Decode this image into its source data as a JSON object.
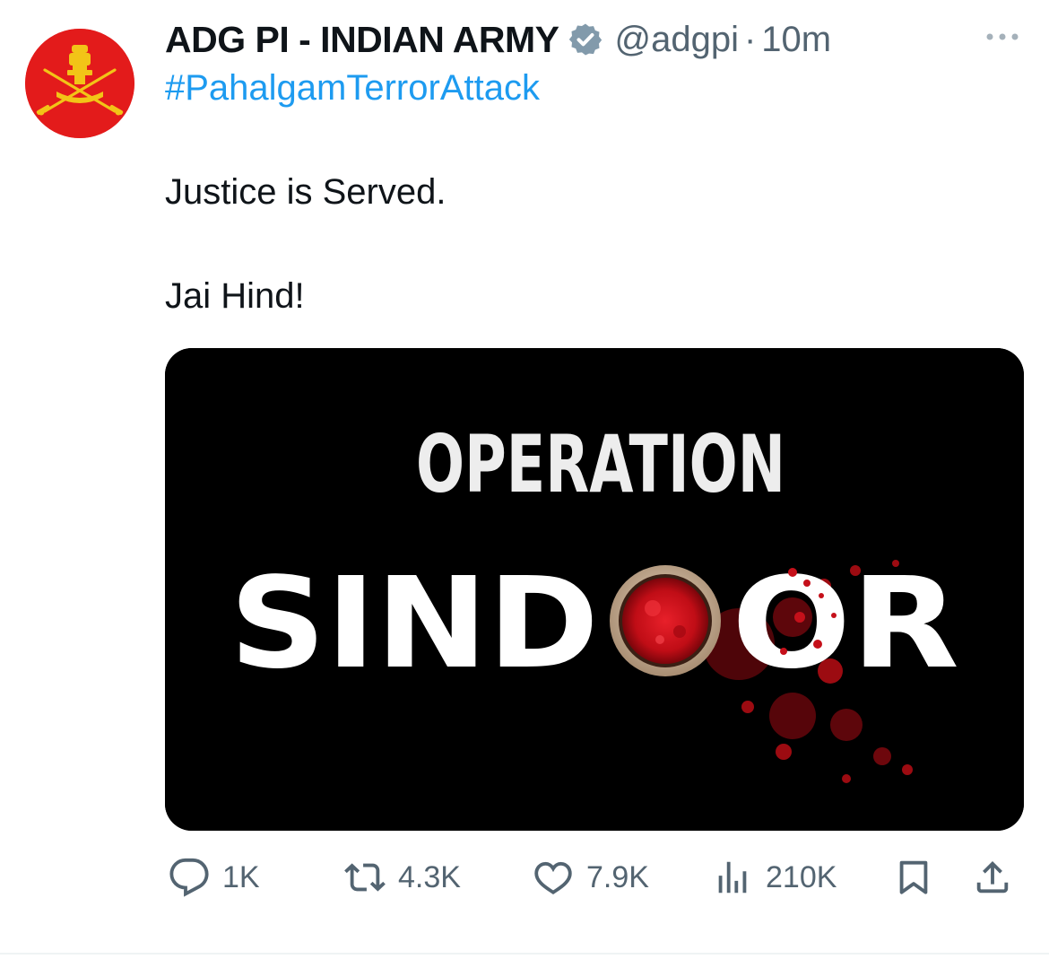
{
  "tweet": {
    "author": {
      "display_name": "ADG PI - INDIAN ARMY",
      "verified_icon": "verified-badge-icon",
      "handle": "@adgpi",
      "separator": "·",
      "time": "10m"
    },
    "hashtag": "#PahalgamTerrorAttack",
    "lines": [
      "Justice is Served.",
      "Jai Hind!"
    ],
    "media": {
      "line1": "OPERATION",
      "line2_left": "SIND",
      "line2_right": "OR"
    },
    "metrics": {
      "replies": "1K",
      "reposts": "4.3K",
      "likes": "7.9K",
      "views": "210K"
    },
    "icons": [
      "more-icon",
      "reply-icon",
      "repost-icon",
      "like-icon",
      "views-icon",
      "bookmark-icon",
      "share-icon"
    ],
    "colors": {
      "link": "#1d9bf0",
      "secondary_text": "#536471",
      "avatar_bg": "#e31b1b",
      "sindoor_red": "#d0101a"
    }
  }
}
